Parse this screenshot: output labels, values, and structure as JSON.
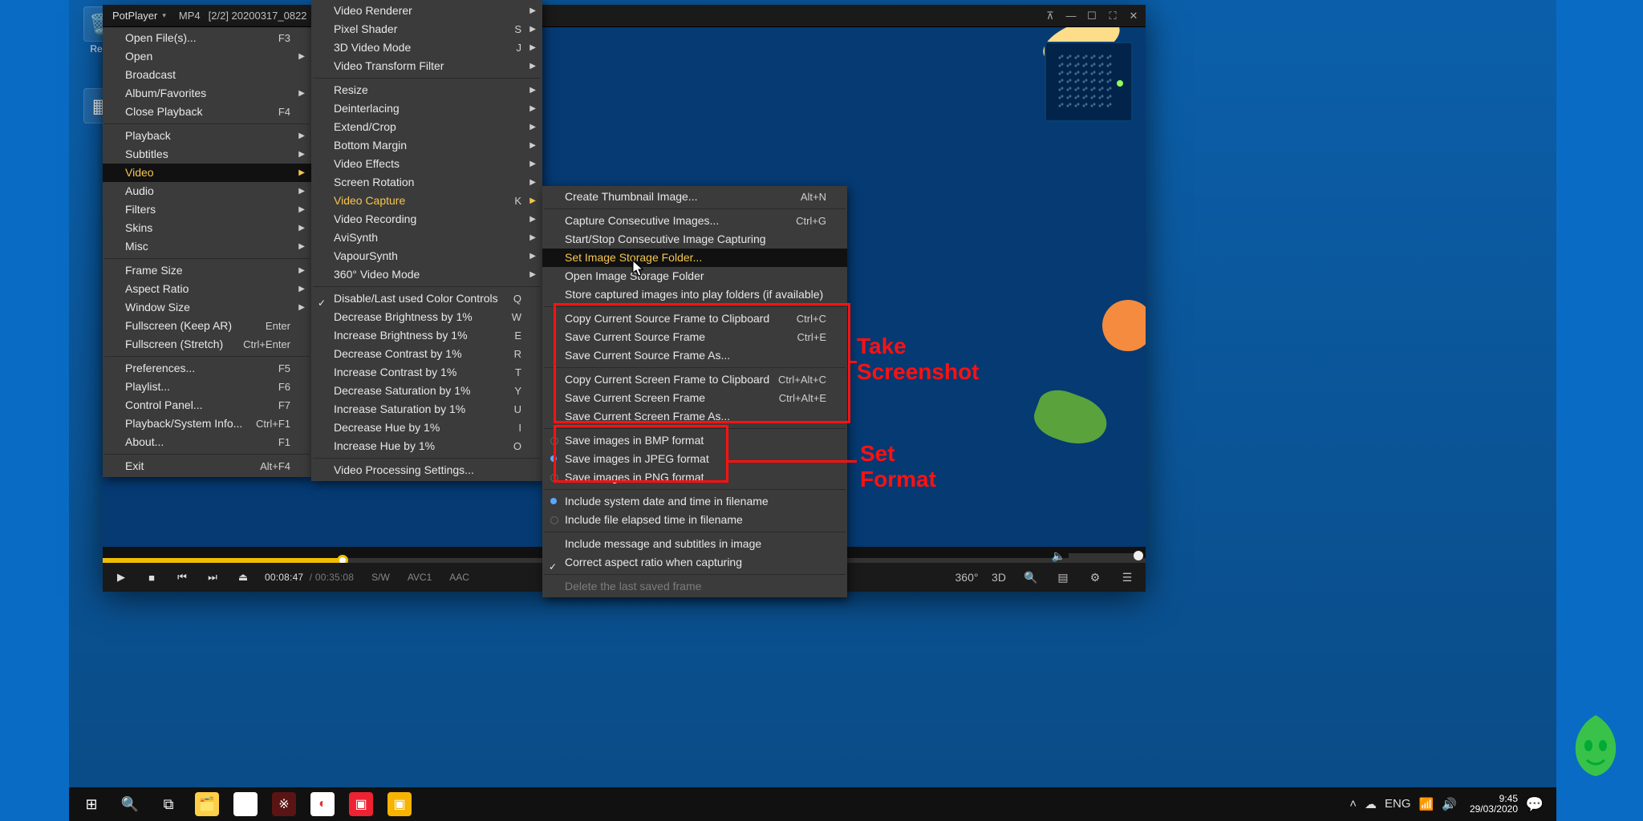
{
  "desktop": {
    "recycle_bin": "Recy"
  },
  "player": {
    "app_name": "PotPlayer",
    "badge1": "MP4",
    "badge2": "[2/2] 20200317_0822",
    "time_cur": "00:08:47",
    "time_dur": "/ 00:35:08",
    "sw": "S/W",
    "codec_v": "AVC1",
    "codec_a": "AAC",
    "ricons": {
      "a": "360°",
      "b": "3D"
    }
  },
  "menu1": [
    {
      "l": "Open File(s)...",
      "s": "F3"
    },
    {
      "l": "Open",
      "sub": true
    },
    {
      "l": "Broadcast"
    },
    {
      "l": "Album/Favorites",
      "sub": true
    },
    {
      "l": "Close Playback",
      "s": "F4"
    },
    {
      "sep": true
    },
    {
      "l": "Playback",
      "sub": true
    },
    {
      "l": "Subtitles",
      "sub": true
    },
    {
      "l": "Video",
      "sub": true,
      "sel": true
    },
    {
      "l": "Audio",
      "sub": true
    },
    {
      "l": "Filters",
      "sub": true
    },
    {
      "l": "Skins",
      "sub": true
    },
    {
      "l": "Misc",
      "sub": true
    },
    {
      "sep": true
    },
    {
      "l": "Frame Size",
      "sub": true
    },
    {
      "l": "Aspect Ratio",
      "sub": true
    },
    {
      "l": "Window Size",
      "sub": true
    },
    {
      "l": "Fullscreen (Keep AR)",
      "s": "Enter"
    },
    {
      "l": "Fullscreen (Stretch)",
      "s": "Ctrl+Enter"
    },
    {
      "sep": true
    },
    {
      "l": "Preferences...",
      "s": "F5"
    },
    {
      "l": "Playlist...",
      "s": "F6"
    },
    {
      "l": "Control Panel...",
      "s": "F7"
    },
    {
      "l": "Playback/System Info...",
      "s": "Ctrl+F1"
    },
    {
      "l": "About...",
      "s": "F1"
    },
    {
      "sep": true
    },
    {
      "l": "Exit",
      "s": "Alt+F4"
    }
  ],
  "menu2": [
    {
      "l": "Video Renderer",
      "sub": true
    },
    {
      "l": "Pixel Shader",
      "s": "S",
      "sub": true
    },
    {
      "l": "3D Video Mode",
      "s": "J",
      "sub": true
    },
    {
      "l": "Video Transform Filter",
      "sub": true
    },
    {
      "sep": true
    },
    {
      "l": "Resize",
      "sub": true
    },
    {
      "l": "Deinterlacing",
      "sub": true
    },
    {
      "l": "Extend/Crop",
      "sub": true
    },
    {
      "l": "Bottom Margin",
      "sub": true
    },
    {
      "l": "Video Effects",
      "sub": true
    },
    {
      "l": "Screen Rotation",
      "sub": true
    },
    {
      "l": "Video Capture",
      "s": "K",
      "sub": true,
      "sel": true
    },
    {
      "l": "Video Recording",
      "sub": true
    },
    {
      "l": "AviSynth",
      "sub": true
    },
    {
      "l": "VapourSynth",
      "sub": true
    },
    {
      "l": "360° Video Mode",
      "sub": true
    },
    {
      "sep": true
    },
    {
      "l": "Disable/Last used Color Controls",
      "s": "Q",
      "tick": true
    },
    {
      "l": "Decrease Brightness by 1%",
      "s": "W"
    },
    {
      "l": "Increase Brightness by 1%",
      "s": "E"
    },
    {
      "l": "Decrease Contrast by 1%",
      "s": "R"
    },
    {
      "l": "Increase Contrast by 1%",
      "s": "T"
    },
    {
      "l": "Decrease Saturation by 1%",
      "s": "Y"
    },
    {
      "l": "Increase Saturation by 1%",
      "s": "U"
    },
    {
      "l": "Decrease Hue by 1%",
      "s": "I"
    },
    {
      "l": "Increase Hue by 1%",
      "s": "O"
    },
    {
      "sep": true
    },
    {
      "l": "Video Processing Settings..."
    }
  ],
  "menu3": [
    {
      "l": "Create Thumbnail Image...",
      "s": "Alt+N"
    },
    {
      "sep": true
    },
    {
      "l": "Capture Consecutive Images...",
      "s": "Ctrl+G"
    },
    {
      "l": "Start/Stop Consecutive Image Capturing"
    },
    {
      "l": "Set Image Storage Folder...",
      "hover": true
    },
    {
      "l": "Open Image Storage Folder"
    },
    {
      "l": "Store captured images into play folders (if available)"
    },
    {
      "sep": true
    },
    {
      "l": "Copy Current Source Frame to Clipboard",
      "s": "Ctrl+C"
    },
    {
      "l": "Save Current Source Frame",
      "s": "Ctrl+E"
    },
    {
      "l": "Save Current Source Frame As..."
    },
    {
      "sep": true
    },
    {
      "l": "Copy Current Screen Frame to Clipboard",
      "s": "Ctrl+Alt+C"
    },
    {
      "l": "Save Current Screen Frame",
      "s": "Ctrl+Alt+E"
    },
    {
      "l": "Save Current Screen Frame As..."
    },
    {
      "sep": true
    },
    {
      "l": "Save images in BMP format",
      "radio": "off"
    },
    {
      "l": "Save images in JPEG format",
      "radio": "on"
    },
    {
      "l": "Save images in PNG format",
      "radio": "off"
    },
    {
      "sep": true
    },
    {
      "l": "Include system date and time in filename",
      "radio": "on"
    },
    {
      "l": "Include file elapsed time in filename",
      "radio": "off"
    },
    {
      "sep": true
    },
    {
      "l": "Include message and subtitles in image"
    },
    {
      "l": "Correct aspect ratio when capturing",
      "tick": true
    },
    {
      "sep": true
    },
    {
      "l": "Delete the last saved frame",
      "dis": true
    }
  ],
  "annotations": {
    "take": "Take\nScreenshot",
    "set": "Set\nFormat"
  },
  "taskbar": {
    "time": "9:45",
    "date": "29/03/2020",
    "lang": "ENG"
  }
}
